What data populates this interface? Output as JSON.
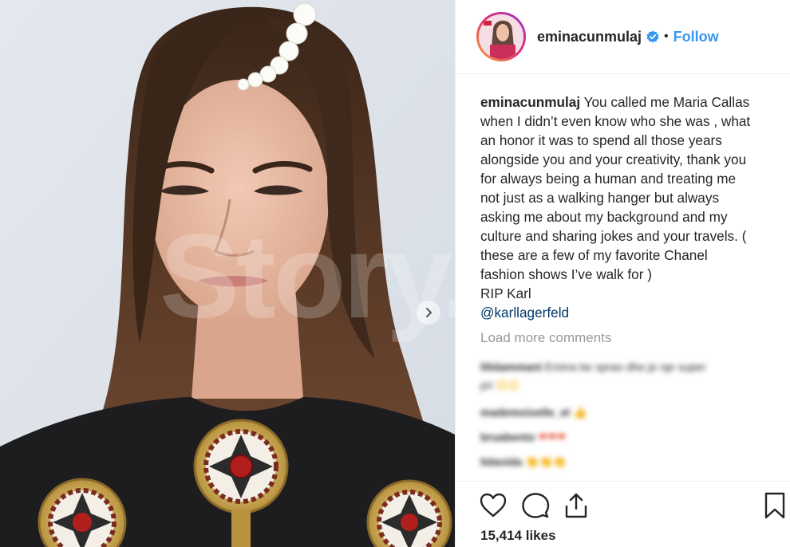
{
  "post": {
    "username": "eminacunmulaj",
    "follow_label": "Follow",
    "separator": "•",
    "watermark": "Story.al"
  },
  "caption": {
    "username": "eminacunmulaj",
    "lines": [
      "You called me Maria Callas",
      "when I didn’t even know who she was , what",
      "an honor it was to spend all those years",
      "alongside you and your creativity, thank you",
      "for always being a human and treating me",
      "not just as a walking hanger but always",
      "asking me about my background and my",
      "culture and sharing jokes and your travels. (",
      "these are a few of my favorite Chanel",
      "fashion shows I’ve walk for )",
      "RIP Karl"
    ],
    "mention": "@karllagerfeld"
  },
  "comments": {
    "load_more": "Load more comments",
    "items": [
      {
        "user": "lilidammani",
        "text": "Emina be sprao dhe je nje super",
        "text2": "pri",
        "emoji": "😊😊"
      },
      {
        "user": "mademoiselle_el",
        "text": "",
        "emoji": "👍"
      },
      {
        "user": "bruabento",
        "text": "",
        "emoji": "❤❤❤"
      },
      {
        "user": "lidavida",
        "text": "",
        "emoji": "👏👏👏"
      }
    ]
  },
  "stats": {
    "likes": "15,414 likes"
  },
  "icons": {
    "like": "heart-icon",
    "comment": "comment-icon",
    "share": "share-icon",
    "save": "bookmark-icon",
    "verified": "verified-badge-icon",
    "next": "chevron-right-icon"
  },
  "colors": {
    "link": "#3897f0",
    "mention": "#003569",
    "muted": "#999999",
    "text": "#262626"
  }
}
